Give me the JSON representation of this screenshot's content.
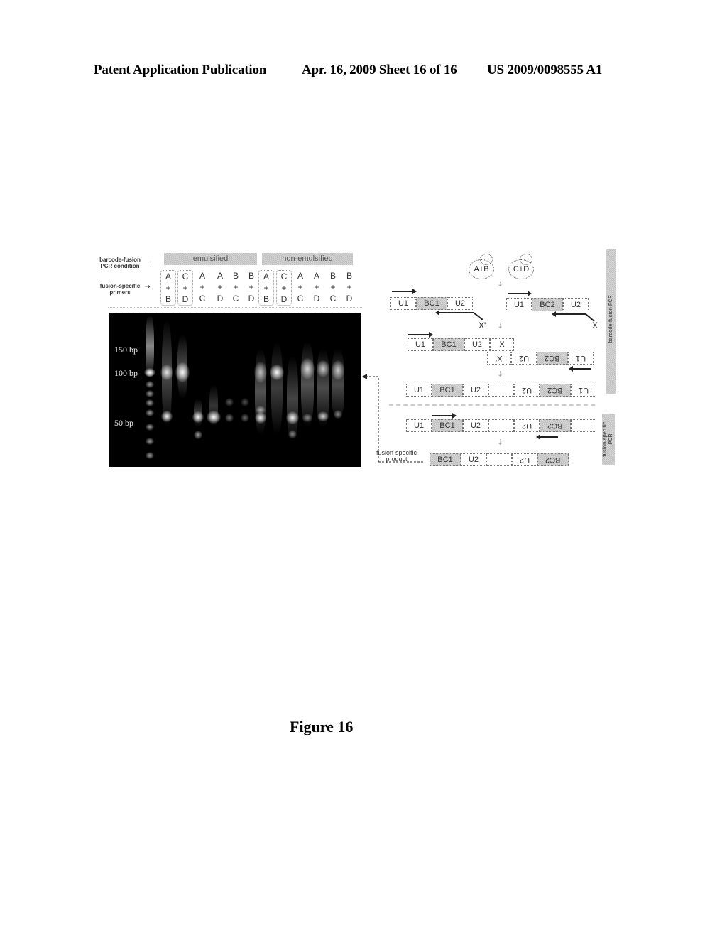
{
  "header": {
    "left": "Patent Application Publication",
    "middle": "Apr. 16, 2009  Sheet 16 of 16",
    "right": "US 2009/0098555 A1"
  },
  "gel_panel": {
    "row_labels": {
      "condition": [
        "barcode-fusion",
        "PCR condition"
      ],
      "primers": [
        "fusion-specific",
        "primers"
      ]
    },
    "conditions": [
      "emulsified",
      "non-emulsified"
    ],
    "lanes": [
      {
        "top": "A",
        "mid": "+",
        "bottom": "B",
        "boxed": true
      },
      {
        "top": "C",
        "mid": "+",
        "bottom": "D",
        "boxed": true
      },
      {
        "top": "A",
        "mid": "+",
        "bottom": "C",
        "boxed": false
      },
      {
        "top": "A",
        "mid": "+",
        "bottom": "D",
        "boxed": false
      },
      {
        "top": "B",
        "mid": "+",
        "bottom": "C",
        "boxed": false
      },
      {
        "top": "B",
        "mid": "+",
        "bottom": "D",
        "boxed": false
      },
      {
        "top": "A",
        "mid": "+",
        "bottom": "B",
        "boxed": true
      },
      {
        "top": "C",
        "mid": "+",
        "bottom": "D",
        "boxed": true
      },
      {
        "top": "A",
        "mid": "+",
        "bottom": "C",
        "boxed": false
      },
      {
        "top": "A",
        "mid": "+",
        "bottom": "D",
        "boxed": false
      },
      {
        "top": "B",
        "mid": "+",
        "bottom": "C",
        "boxed": false
      },
      {
        "top": "B",
        "mid": "+",
        "bottom": "D",
        "boxed": false
      }
    ],
    "size_markers": [
      "150 bp",
      "100 bp",
      "50 bp"
    ]
  },
  "diagram": {
    "blobs": [
      "A+B",
      "C+D"
    ],
    "segments": {
      "u1": "U1",
      "bc1": "BC1",
      "u2": "U2",
      "bc2": "BC2",
      "x": "X",
      "xprime": "X'"
    },
    "x_labels": {
      "left": "X'",
      "right": "X"
    },
    "fusion_product_label": [
      "fusion-specific",
      "product"
    ],
    "stage_labels": {
      "barcode_fusion": "barcode-fusion PCR",
      "fusion_specific": [
        "fusion-specific",
        "PCR"
      ]
    }
  },
  "caption": "Figure 16"
}
